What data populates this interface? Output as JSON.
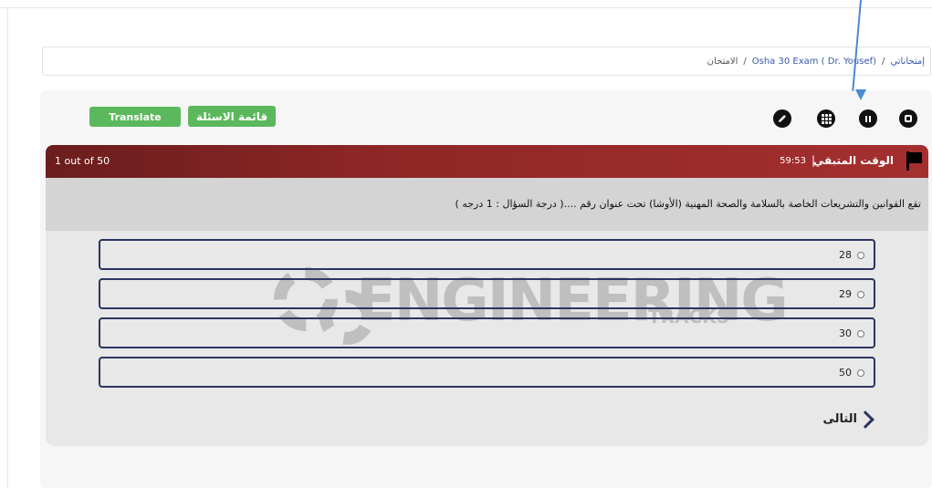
{
  "breadcrumb": {
    "home": "إمتحاناتي",
    "sep1": "/",
    "exam": "Osha 30 Exam ( Dr. Yousef)",
    "sep2": "/",
    "current": "الامتحان"
  },
  "toolbar": {
    "translate_label": "Translate",
    "questions_list_label": "قائمة الاسئلة",
    "icons": [
      "pencil-icon",
      "qr-icon",
      "pause-icon",
      "stop-icon"
    ]
  },
  "exam_header": {
    "counter": "1 out of 50",
    "timer_label": "الوقت المتبقي",
    "timer_separator": "|",
    "timer_value": "59:53"
  },
  "question": {
    "text": "تقع القوانين والتشريعات الخاصة بالسلامة والصحة المهنية (الأوشا) تحت عنوان رقم ....(  درجة السؤال : 1 درجه )"
  },
  "answers": [
    {
      "label": "28"
    },
    {
      "label": "29"
    },
    {
      "label": "30"
    },
    {
      "label": "50"
    }
  ],
  "navigation": {
    "next_label": "التالى"
  },
  "watermark": {
    "word": "ENGINEERING",
    "sub": "TRACKS"
  },
  "colors": {
    "header_dark": "#6b1d1d",
    "header_light": "#a52f2f",
    "green_button": "#5cb85c",
    "answer_border": "#2c3560",
    "annotation_arrow": "#4a8ad4"
  }
}
